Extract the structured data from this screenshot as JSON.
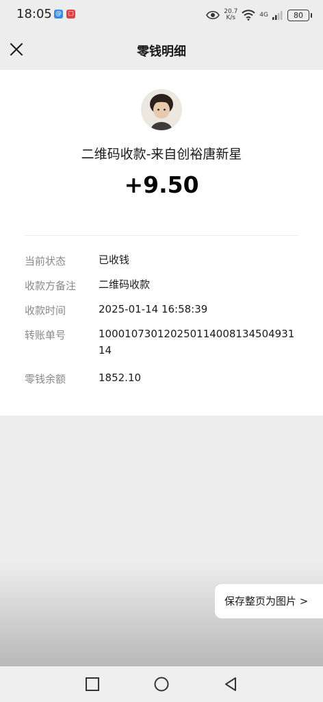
{
  "status_bar": {
    "time": "18:05",
    "speed_value": "20.7",
    "speed_unit": "K/s",
    "network": "4G",
    "battery": "80"
  },
  "header": {
    "title": "零钱明细"
  },
  "transaction": {
    "title": "二维码收款-来自创裕唐新星",
    "amount": "+9.50",
    "details": [
      {
        "label": "当前状态",
        "value": "已收钱"
      },
      {
        "label": "收款方备注",
        "value": "二维码收款"
      },
      {
        "label": "收款时间",
        "value": "2025-01-14 16:58:39"
      },
      {
        "label": "转账单号",
        "value": "100010730120250114008134504931 14"
      },
      {
        "label": "零钱余额",
        "value": "1852.10"
      }
    ]
  },
  "actions": {
    "save_label": "保存整页为图片 >"
  },
  "icons": {
    "close": "close-icon",
    "eye": "eye-icon",
    "wifi": "wifi-icon",
    "signal": "signal-icon",
    "nav_recent": "square-icon",
    "nav_home": "circle-icon",
    "nav_back": "triangle-back-icon"
  }
}
